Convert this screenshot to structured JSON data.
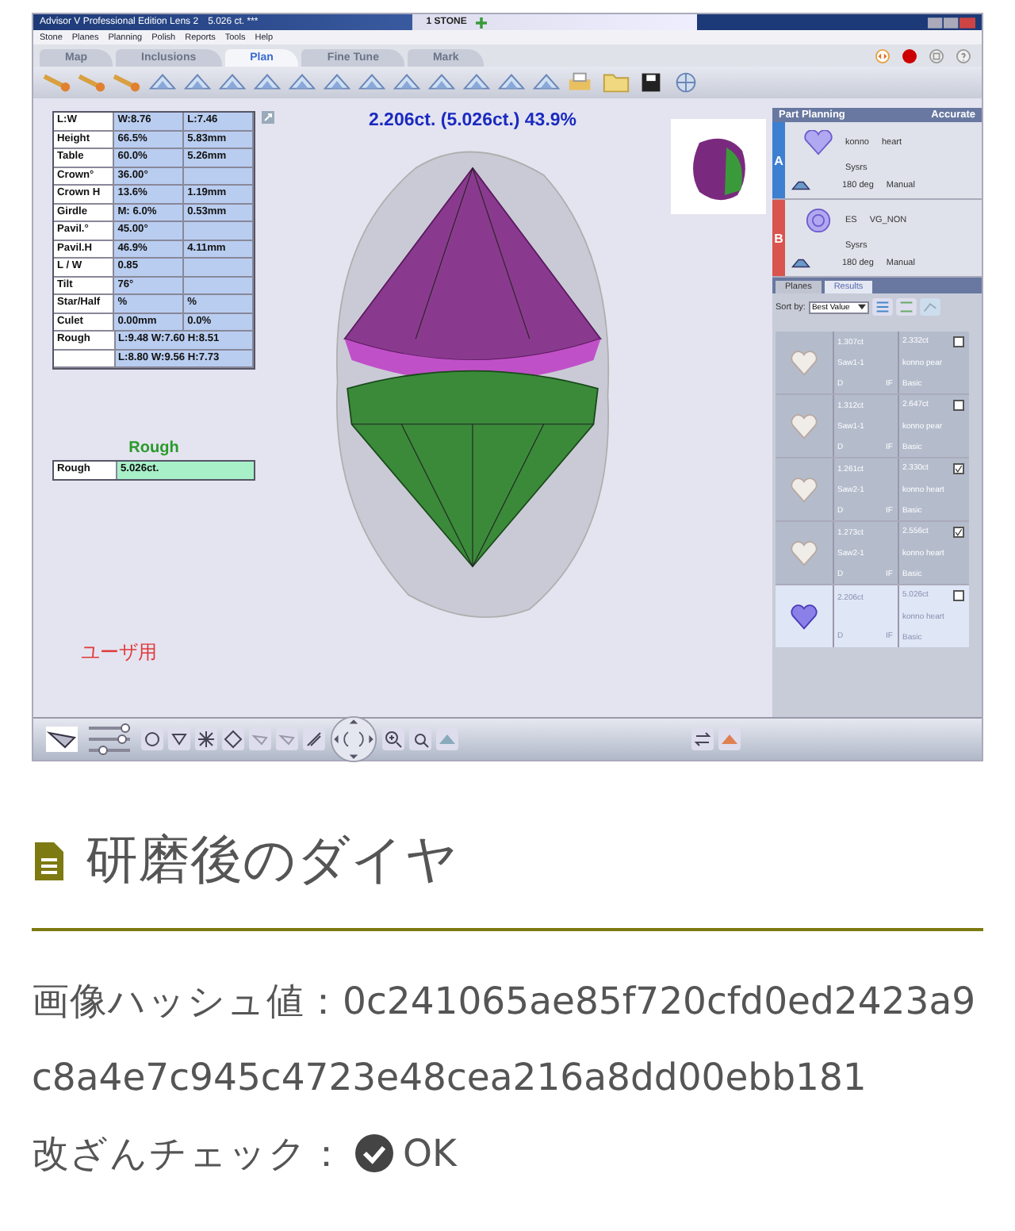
{
  "app": {
    "title_bar": {
      "title": "Advisor V Professional Edition Lens 2",
      "file": "5.026 ct. ***",
      "document": "1 STONE"
    },
    "menu": [
      "Stone",
      "Planes",
      "Planning",
      "Polish",
      "Reports",
      "Tools",
      "Help"
    ],
    "tabs": [
      {
        "label": "Map",
        "selected": false
      },
      {
        "label": "Inclusions",
        "selected": false
      },
      {
        "label": "Plan",
        "selected": true
      },
      {
        "label": "Fine Tune",
        "selected": false
      },
      {
        "label": "Mark",
        "selected": false
      }
    ],
    "measurements": [
      {
        "label": "L:W",
        "value_1": "W:8.76",
        "value_2": "L:7.46",
        "kind": "normal"
      },
      {
        "label": "Height",
        "value_1": "66.5%",
        "value_2": "5.83mm",
        "kind": "normal"
      },
      {
        "label": "Table",
        "value_1": "60.0%",
        "value_2": "5.26mm",
        "kind": "normal"
      },
      {
        "label": "Crown°",
        "value_1": "36.00°",
        "kind": "normal"
      },
      {
        "label": "Crown H",
        "value_1": "13.6%",
        "value_2": "1.19mm",
        "kind": "normal"
      },
      {
        "label": "Girdle",
        "value_1": "M: 6.0%",
        "value_2": "0.53mm",
        "kind": "normal"
      },
      {
        "label": "Pavil.°",
        "value_1": "45.00°",
        "kind": "normal"
      },
      {
        "label": "Pavil.H",
        "value_1": "46.9%",
        "value_2": "4.11mm",
        "kind": "normal"
      },
      {
        "label": "L / W",
        "value_1": "0.85",
        "kind": "normal"
      },
      {
        "label": "Tilt",
        "value_1": "76°",
        "kind": "normal"
      },
      {
        "label": "Star/Half",
        "value_1": "%",
        "value_2": "%",
        "kind": "normal"
      },
      {
        "label": "Culet",
        "value_1": "0.00mm",
        "value_2": "0.0%",
        "kind": "normal"
      },
      {
        "label": "Rough",
        "value_1": "L:9.48 W:7.60 H:8.51",
        "kind": "wide"
      },
      {
        "value_1": "L:8.80 W:9.56 H:7.73",
        "kind": "wide"
      }
    ],
    "result_heading": "2.206ct. (5.026ct.) 43.9%",
    "rough": {
      "heading": "Rough",
      "label": "Rough",
      "value": "5.026ct."
    },
    "overlay_label": "ユーザ用",
    "part_planning": {
      "title": "Part Planning",
      "mode": "Accurate",
      "parts": [
        {
          "letter": "A",
          "color": "#3d7fd1",
          "kind": "heart",
          "name": "konno",
          "cut": "heart",
          "method": "Sysrs",
          "angle": "180 deg",
          "placement": "Manual"
        },
        {
          "letter": "B",
          "color": "#d9534f",
          "kind": "round",
          "name": "ES",
          "cut": "VG_NON",
          "method": "Sysrs",
          "angle": "180 deg",
          "placement": "Manual"
        }
      ]
    },
    "panel_tabs": [
      {
        "label": "Planes",
        "selected": false
      },
      {
        "label": "Results",
        "selected": true
      }
    ],
    "sort": {
      "label": "Sort by:",
      "value": "Best Value"
    },
    "results": [
      {
        "weight": "1.307ct",
        "name": "Saw1-1",
        "color_grade": "D",
        "clarity": "IF",
        "rough_weight": "2.332ct",
        "shape": "konno pear",
        "mode": "Basic",
        "checked": false,
        "selected": false
      },
      {
        "weight": "1.312ct",
        "name": "Saw1-1",
        "color_grade": "D",
        "clarity": "IF",
        "rough_weight": "2.647ct",
        "shape": "konno pear",
        "mode": "Basic",
        "checked": false,
        "selected": false
      },
      {
        "weight": "1.261ct",
        "name": "Saw2-1",
        "color_grade": "D",
        "clarity": "IF",
        "rough_weight": "2.330ct",
        "shape": "konno heart",
        "mode": "Basic",
        "checked": true,
        "selected": false
      },
      {
        "weight": "1.273ct",
        "name": "Saw2-1",
        "color_grade": "D",
        "clarity": "IF",
        "rough_weight": "2.556ct",
        "shape": "konno heart",
        "mode": "Basic",
        "checked": true,
        "selected": false
      },
      {
        "weight": "2.206ct",
        "color_grade": "D",
        "clarity": "IF",
        "rough_weight": "5.026ct",
        "shape": "konno heart",
        "mode": "Basic",
        "checked": false,
        "selected": true
      }
    ],
    "view_sliders": [
      {
        "level": 0.9
      },
      {
        "level": 0.8
      },
      {
        "level": 0.35
      }
    ]
  },
  "section_title": "研磨後のダイヤ",
  "hash": {
    "label": "画像ハッシュ値：",
    "value": "0c241065ae85f720cfd0ed2423a9c8a4e7c945c4723e48cea216a8dd00ebb181"
  },
  "tamper_check": {
    "label": "改ざんチェック：",
    "value": "OK"
  }
}
